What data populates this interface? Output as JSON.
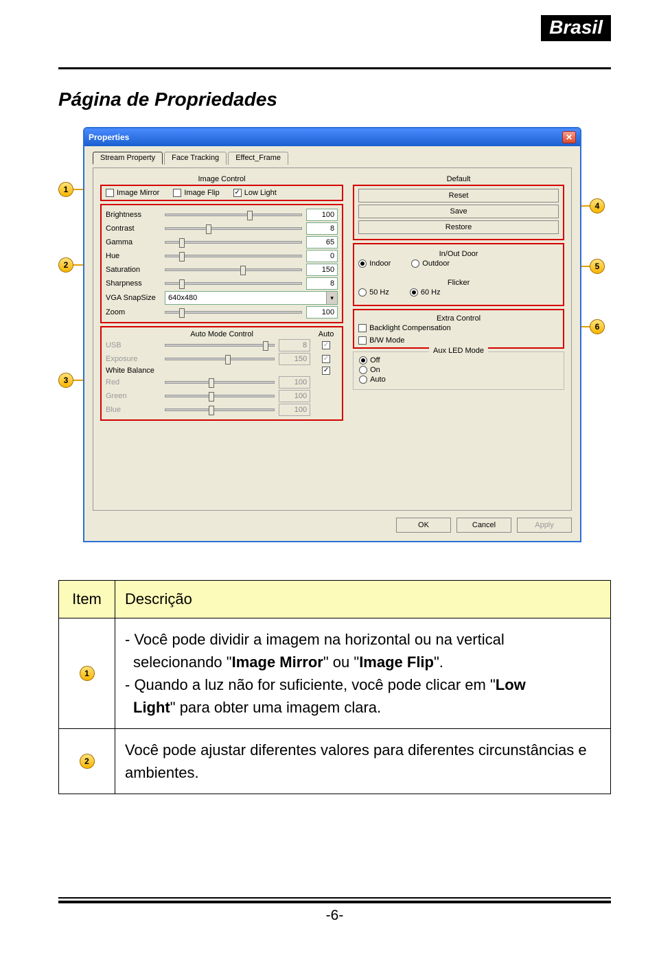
{
  "region_badge": "Brasil",
  "page_title": "Página de Propriedades",
  "page_number": "-6-",
  "callouts": {
    "c1": "1",
    "c2": "2",
    "c3": "3",
    "c4": "4",
    "c5": "5",
    "c6": "6"
  },
  "dialog": {
    "title": "Properties",
    "tabs": [
      "Stream Property",
      "Face Tracking",
      "Effect_Frame"
    ],
    "image_control_label": "Image Control",
    "checks": {
      "mirror": "Image Mirror",
      "flip": "Image Flip",
      "low": "Low Light"
    },
    "sliders": {
      "brightness": {
        "label": "Brightness",
        "value": "100",
        "pos": 60
      },
      "contrast": {
        "label": "Contrast",
        "value": "8",
        "pos": 30
      },
      "gamma": {
        "label": "Gamma",
        "value": "65",
        "pos": 10
      },
      "hue": {
        "label": "Hue",
        "value": "0",
        "pos": 10
      },
      "saturation": {
        "label": "Saturation",
        "value": "150",
        "pos": 55
      },
      "sharpness": {
        "label": "Sharpness",
        "value": "8",
        "pos": 10
      },
      "zoom": {
        "label": "Zoom",
        "value": "100",
        "pos": 10
      }
    },
    "snapsize": {
      "label": "VGA SnapSize",
      "value": "640x480"
    },
    "autoctrl_label": "Auto Mode Control",
    "autoctrl_auto": "Auto",
    "auto_rows": {
      "usb": {
        "label": "USB",
        "value": "8",
        "auto": true,
        "disabled": true,
        "pos": 90
      },
      "exposure": {
        "label": "Exposure",
        "value": "150",
        "auto": true,
        "disabled": true,
        "pos": 55
      },
      "wb": {
        "label": "White Balance",
        "value": "",
        "auto": true,
        "disabled": false,
        "noslider": true
      },
      "red": {
        "label": "Red",
        "value": "100",
        "auto": false,
        "disabled": true,
        "pos": 40,
        "noauto": true
      },
      "green": {
        "label": "Green",
        "value": "100",
        "auto": false,
        "disabled": true,
        "pos": 40,
        "noauto": true
      },
      "blue": {
        "label": "Blue",
        "value": "100",
        "auto": false,
        "disabled": true,
        "pos": 40,
        "noauto": true
      }
    },
    "default_label": "Default",
    "btn_reset": "Reset",
    "btn_save": "Save",
    "btn_restore": "Restore",
    "grp_inout": "In/Out Door",
    "radio_indoor": "Indoor",
    "radio_outdoor": "Outdoor",
    "grp_flicker": "Flicker",
    "radio_50": "50 Hz",
    "radio_60": "60 Hz",
    "grp_extra": "Extra Control",
    "chk_backlight": "Backlight Compensation",
    "chk_bw": "B/W Mode",
    "grp_aux": "Aux LED Mode",
    "radio_off": "Off",
    "radio_on": "On",
    "radio_auto": "Auto",
    "btn_ok": "OK",
    "btn_cancel": "Cancel",
    "btn_apply": "Apply"
  },
  "table": {
    "h_item": "Item",
    "h_desc": "Descrição",
    "row1": {
      "line1": "- Você pode dividir a imagem na horizontal ou na vertical",
      "line2": "selecionando \"Image Mirror\" ou \"Image Flip\".",
      "line3": "- Quando a luz não for suficiente, você pode clicar  em \"Low",
      "line4": "Light\" para obter uma imagem clara."
    },
    "row2": "Você pode ajustar diferentes valores para diferentes circunstâncias e ambientes."
  }
}
